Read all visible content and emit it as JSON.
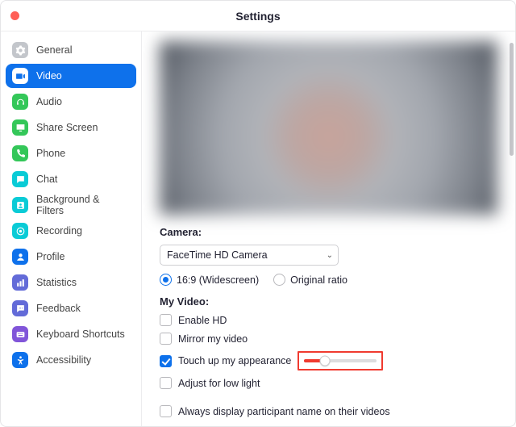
{
  "window": {
    "title": "Settings"
  },
  "sidebar": {
    "items": [
      {
        "label": "General"
      },
      {
        "label": "Video"
      },
      {
        "label": "Audio"
      },
      {
        "label": "Share Screen"
      },
      {
        "label": "Phone"
      },
      {
        "label": "Chat"
      },
      {
        "label": "Background & Filters"
      },
      {
        "label": "Recording"
      },
      {
        "label": "Profile"
      },
      {
        "label": "Statistics"
      },
      {
        "label": "Feedback"
      },
      {
        "label": "Keyboard Shortcuts"
      },
      {
        "label": "Accessibility"
      }
    ]
  },
  "video": {
    "camera_label": "Camera:",
    "camera_select": "FaceTime HD Camera",
    "aspect": {
      "widescreen": "16:9 (Widescreen)",
      "original": "Original ratio"
    },
    "myvideo_label": "My Video:",
    "enable_hd": "Enable HD",
    "mirror": "Mirror my video",
    "touchup": "Touch up my appearance",
    "touchup_slider_pct": 28,
    "low_light": "Adjust for low light",
    "always_display": "Always display participant name on their videos"
  }
}
